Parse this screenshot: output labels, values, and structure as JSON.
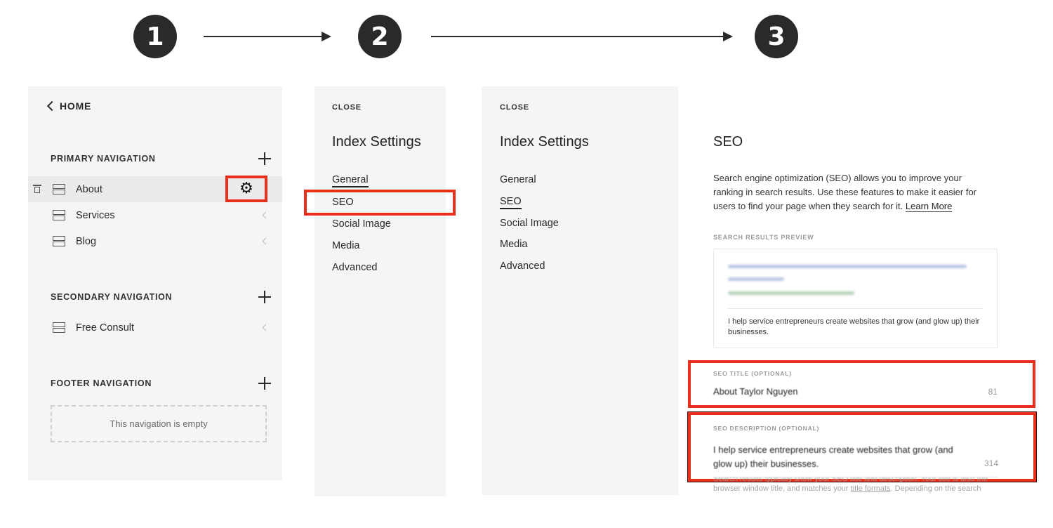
{
  "steps": [
    {
      "number": "1"
    },
    {
      "number": "2"
    },
    {
      "number": "3"
    }
  ],
  "panel1": {
    "home_label": "HOME",
    "sections": [
      {
        "title": "PRIMARY NAVIGATION",
        "items": [
          {
            "label": "About",
            "active": true,
            "icon": "page-icon"
          },
          {
            "label": "Services",
            "icon": "page-icon"
          },
          {
            "label": "Blog",
            "icon": "page-icon"
          }
        ]
      },
      {
        "title": "SECONDARY NAVIGATION",
        "items": [
          {
            "label": "Free Consult",
            "icon": "page-icon"
          }
        ]
      },
      {
        "title": "FOOTER NAVIGATION",
        "empty_text": "This navigation is empty"
      }
    ],
    "icons": {
      "add": "plus-icon",
      "settings": "gear-icon",
      "delete": "trash-icon",
      "expand": "chevron-left-icon"
    },
    "gear_glyph": "⚙"
  },
  "panel2": {
    "close_label": "CLOSE",
    "title": "Index Settings",
    "items": [
      "General",
      "SEO",
      "Social Image",
      "Media",
      "Advanced"
    ],
    "selected": "General",
    "highlighted": "SEO"
  },
  "panel3": {
    "close_label": "CLOSE",
    "title": "Index Settings",
    "items": [
      "General",
      "SEO",
      "Social Image",
      "Media",
      "Advanced"
    ],
    "selected": "SEO"
  },
  "panel4": {
    "heading": "SEO",
    "intro": "Search engine optimization (SEO) allows you to improve your ranking in search results. Use these features to make it easier for users to find your page when they search for it.",
    "learn_more": "Learn More",
    "preview_label": "SEARCH RESULTS PREVIEW",
    "preview_description": "I help service entrepreneurs create websites that grow (and glow up) their businesses.",
    "seo_title": {
      "label": "SEO TITLE (OPTIONAL)",
      "value": "About Taylor Nguyen",
      "count": "81"
    },
    "seo_description": {
      "label": "SEO DESCRIPTION (OPTIONAL)",
      "value": "I help service entrepreneurs create websites that grow (and glow up) their businesses.",
      "count": "314"
    },
    "helper_line1": "Search results typically show your SEO title and description. Your title is also the",
    "helper_before_link": "browser window title, and matches your ",
    "helper_link": "title formats",
    "helper_after_link": ". Depending on the search"
  },
  "colors": {
    "highlight": "#e8301c",
    "step_fill": "#2b2a28",
    "panel_bg": "#f5f5f5"
  }
}
